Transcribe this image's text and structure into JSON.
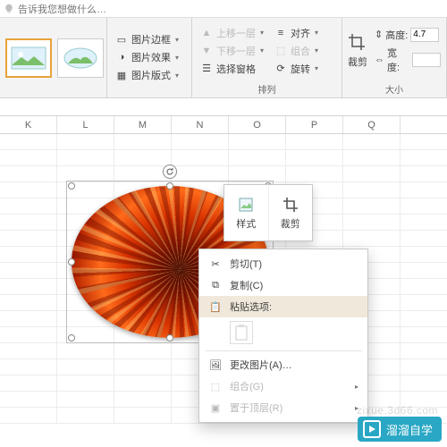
{
  "tellme_placeholder": "告诉我您想做什么…",
  "ribbon": {
    "pic_border": "图片边框",
    "pic_effect": "图片效果",
    "pic_layout": "图片版式",
    "bring_fwd": "上移一层",
    "send_back": "下移一层",
    "selection_pane": "选择窗格",
    "align": "对齐",
    "group": "组合",
    "rotate": "旋转",
    "arrange_label": "排列",
    "crop": "裁剪",
    "height_label": "高度:",
    "width_label": "宽度:",
    "height_val": "4.7",
    "width_val": "",
    "size_label": "大小"
  },
  "columns": [
    "K",
    "L",
    "M",
    "N",
    "O",
    "P",
    "Q"
  ],
  "mini": {
    "style": "样式",
    "crop": "裁剪"
  },
  "ctx": {
    "cut": "剪切(T)",
    "copy": "复制(C)",
    "paste_label": "粘贴选项:",
    "change_pic": "更改图片(A)…",
    "group": "组合(G)",
    "bring_front": "置于顶层(R)"
  },
  "brand": {
    "text": "溜溜自学",
    "url": "zixue.3d66.com"
  }
}
